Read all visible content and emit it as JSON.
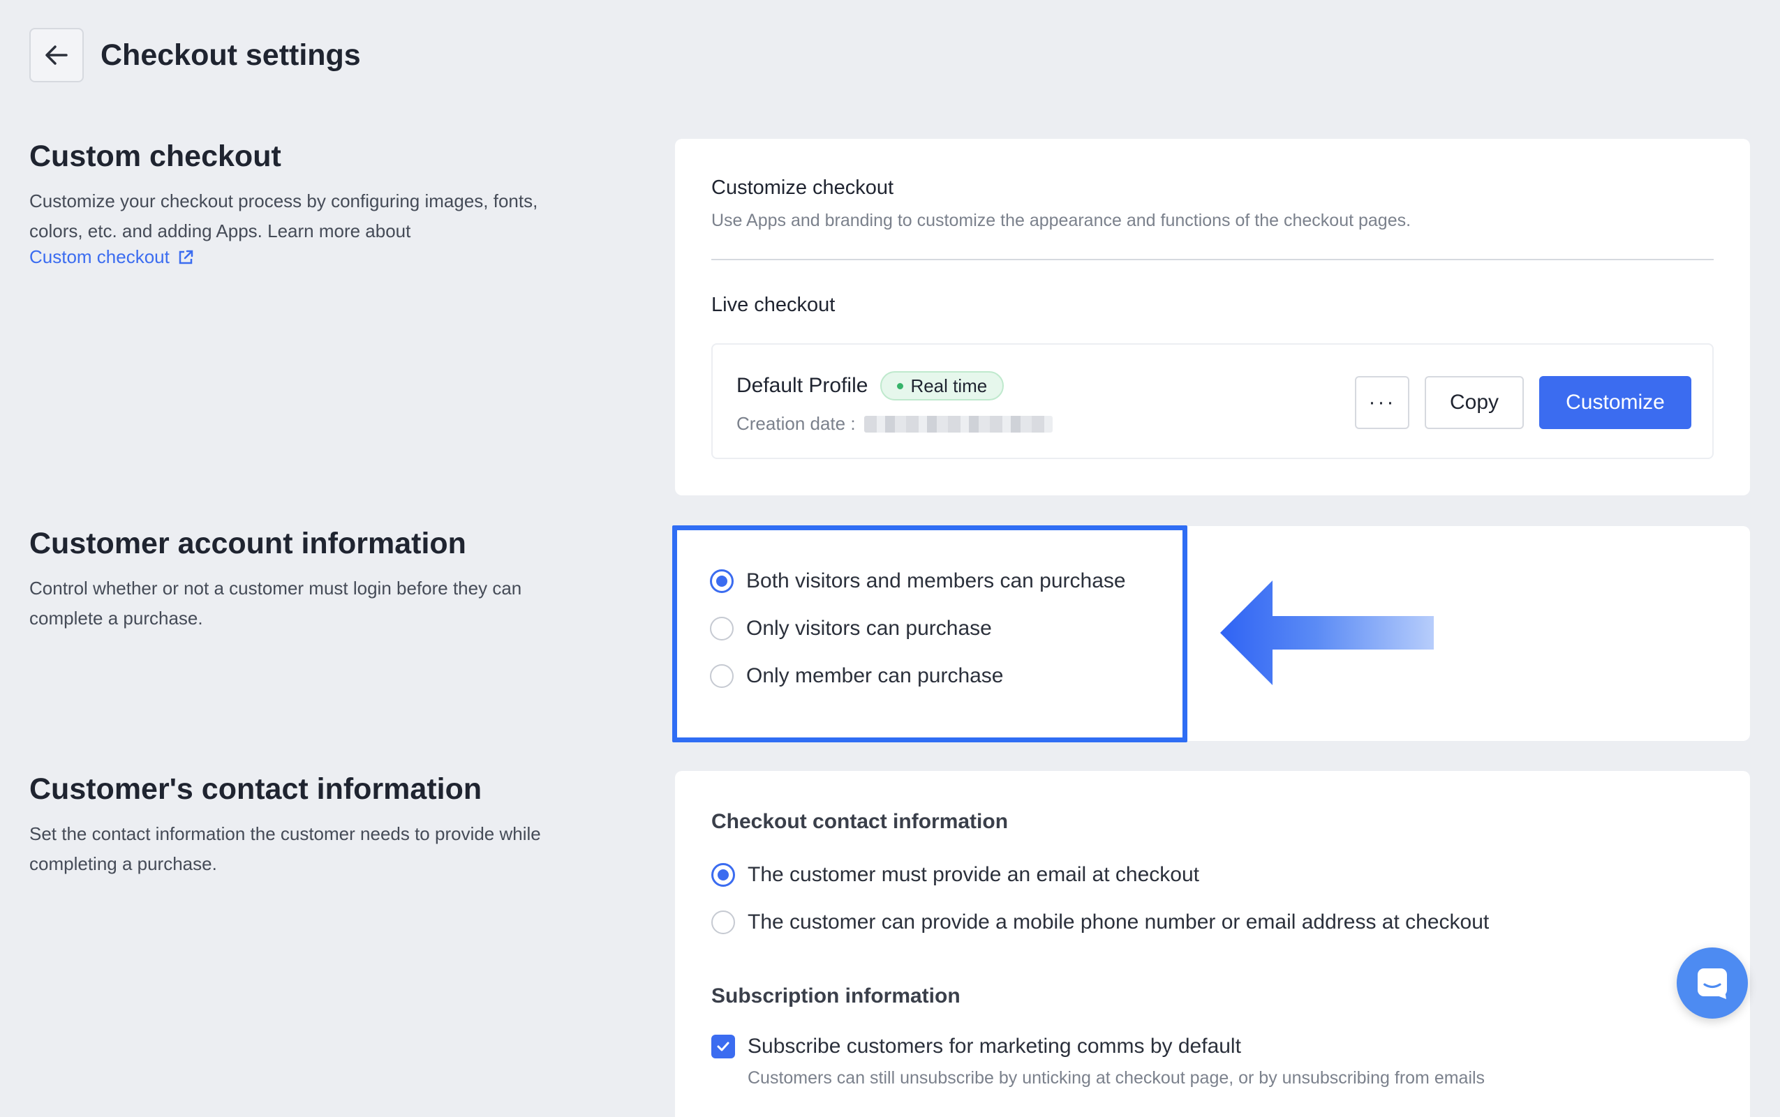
{
  "header": {
    "title": "Checkout settings"
  },
  "custom_checkout": {
    "title": "Custom checkout",
    "description": "Customize your checkout process by configuring images, fonts, colors, etc. and adding Apps. Learn more about",
    "link_label": "Custom checkout"
  },
  "customize_card": {
    "title": "Customize checkout",
    "description": "Use Apps and branding to customize the appearance and functions of the checkout pages.",
    "live_title": "Live checkout",
    "profile": {
      "name": "Default Profile",
      "badge": "Real time",
      "creation_label": "Creation date :"
    },
    "buttons": {
      "more": "···",
      "copy": "Copy",
      "customize": "Customize"
    }
  },
  "account_info": {
    "title": "Customer account information",
    "description": "Control whether or not a customer must login before they can complete a purchase.",
    "options": [
      {
        "label": "Both visitors and members can purchase",
        "selected": true
      },
      {
        "label": "Only visitors can purchase",
        "selected": false
      },
      {
        "label": "Only member can purchase",
        "selected": false
      }
    ]
  },
  "contact_info": {
    "title": "Customer's contact information",
    "description": "Set the contact information the customer needs to provide while completing a purchase.",
    "checkout_contact_title": "Checkout contact information",
    "options": [
      {
        "label": "The customer must provide an email at checkout",
        "selected": true
      },
      {
        "label": "The customer can provide a mobile phone number or email address at checkout",
        "selected": false
      }
    ],
    "subscription_title": "Subscription information",
    "subscription_checkbox": "Subscribe customers for marketing comms by default",
    "subscription_helper": "Customers can still unsubscribe by unticking at checkout page, or by unsubscribing from emails"
  },
  "colors": {
    "accent": "#3b6cf0",
    "highlight": "#2f6df4",
    "badge_bg": "#e6f7ec",
    "chat": "#4d8bf2"
  },
  "icons": {
    "back": "arrow-left-icon",
    "external": "external-link-icon",
    "chat": "chat-icon",
    "check": "checkmark-icon"
  }
}
